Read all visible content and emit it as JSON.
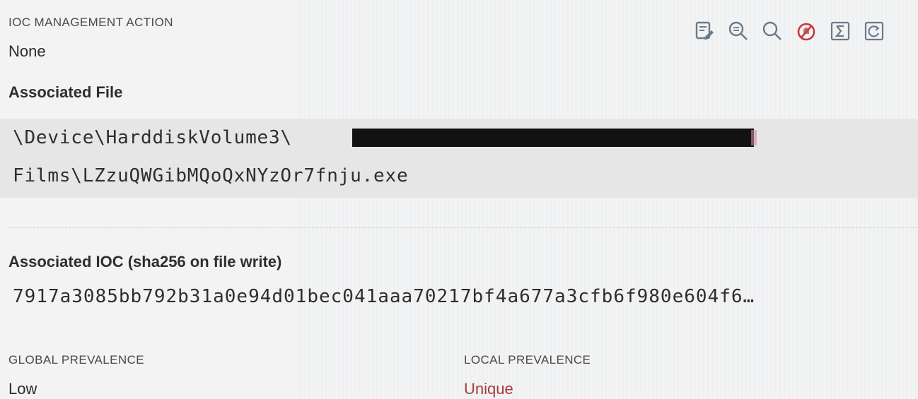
{
  "ioc_action": {
    "label": "IOC MANAGEMENT ACTION",
    "value": "None"
  },
  "toolbar": {
    "icons": [
      "edit-note-icon",
      "zoom-in-icon",
      "search-icon",
      "no-block-icon",
      "sum-icon",
      "refresh-icon"
    ]
  },
  "associated_file": {
    "heading": "Associated File",
    "line1": "\\Device\\HarddiskVolume3\\",
    "line2": "Films\\LZzuQWGibMQoQxNYzOr7fnju.exe"
  },
  "associated_ioc": {
    "heading": "Associated IOC (sha256 on file write)",
    "hash": "7917a3085bb792b31a0e94d01bec041aaa70217bf4a677a3cfb6f980e604f6…"
  },
  "prevalence": {
    "global_label": "GLOBAL PREVALENCE",
    "global_value": "Low",
    "local_label": "LOCAL PREVALENCE",
    "local_value": "Unique"
  },
  "colors": {
    "icon": "#6b7a8a",
    "accent_red": "#c23b3b",
    "unique": "#a83a3a"
  }
}
